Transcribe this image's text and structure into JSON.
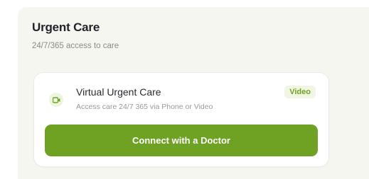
{
  "section": {
    "title": "Urgent Care",
    "subtitle": "24/7/365 access to care"
  },
  "card": {
    "icon": "video-camera-icon",
    "title": "Virtual Urgent Care",
    "description": "Access care 24/7 365 via Phone or Video",
    "tag": "Video",
    "cta_label": "Connect with a Doctor"
  },
  "colors": {
    "accent": "#6fa223",
    "panel_background": "#f6f6f1",
    "tag_background": "#f1f6e4"
  }
}
